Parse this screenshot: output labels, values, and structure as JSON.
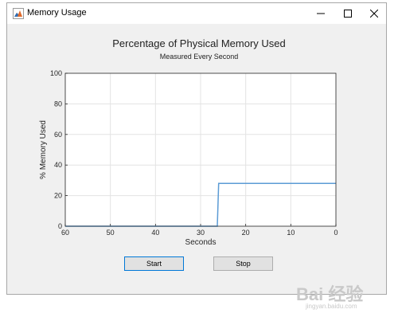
{
  "window": {
    "title": "Memory Usage"
  },
  "chart_data": {
    "type": "line",
    "title": "Percentage of Physical Memory Used",
    "subtitle": "Measured Every Second",
    "xlabel": "Seconds",
    "ylabel": "% Memory Used",
    "x_reversed": true,
    "xlim": [
      0,
      60
    ],
    "ylim": [
      0,
      100
    ],
    "xticks": [
      60,
      50,
      40,
      30,
      20,
      10,
      0
    ],
    "yticks": [
      0,
      20,
      40,
      60,
      80,
      100
    ],
    "grid": true,
    "line_color": "#5b9bd5",
    "series": [
      {
        "x": [
          60,
          27,
          26.3,
          26,
          20,
          10,
          0
        ],
        "y": [
          0,
          0,
          0,
          28,
          28,
          28,
          28
        ]
      }
    ]
  },
  "buttons": {
    "start": "Start",
    "stop": "Stop"
  },
  "watermark": {
    "text": "Bai 经验",
    "sub": "jingyan.baidu.com"
  }
}
